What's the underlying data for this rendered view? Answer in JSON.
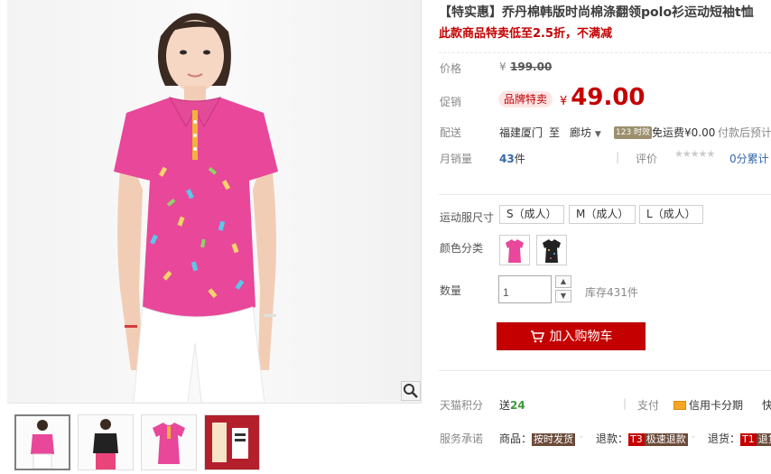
{
  "title": "【特实惠】乔丹棉韩版时尚棉涤翻领polo衫运动短袖t恤",
  "subtitle": "此款商品特卖低至2.5折，不满减",
  "price": {
    "label": "价格",
    "currency": "¥",
    "original": "199.00"
  },
  "promo": {
    "label": "促销",
    "badge": "品牌特卖",
    "currency": "¥",
    "value": "49.00"
  },
  "shipping": {
    "label": "配送",
    "from": "福建厦门",
    "to_word": "至",
    "to": "廊坊",
    "badge": "123 时效",
    "fee": "免运费¥0.00",
    "note": "付款后预计"
  },
  "sales": {
    "label": "月销量",
    "count": "43",
    "unit": "件",
    "review_label": "评价",
    "score_text": "0分累计"
  },
  "size": {
    "label": "运动服尺寸",
    "options": [
      "S（成人）",
      "M（成人）",
      "L（成人）"
    ]
  },
  "color": {
    "label": "颜色分类",
    "swatches": [
      "pink-polo",
      "black-polo"
    ]
  },
  "quantity": {
    "label": "数量",
    "value": "1",
    "stock": "库存431件"
  },
  "cart_button": {
    "label": "加入购物车"
  },
  "points": {
    "label": "天猫积分",
    "text_prefix": "送",
    "value": "24"
  },
  "payment": {
    "label": "支付",
    "credit": "信用卡分期",
    "more": "快"
  },
  "service": {
    "label": "服务承诺",
    "items": [
      {
        "prefix": "商品：",
        "tag": "按时发货"
      },
      {
        "prefix": "退款：",
        "tag_code": "T3",
        "tag": "极速退款"
      },
      {
        "prefix": "退货：",
        "tag_code": "T1",
        "tag": "退货"
      }
    ]
  },
  "colors": {
    "accent": "#c40000",
    "sales_count": "#3366aa",
    "points": "#3c9a3c"
  }
}
